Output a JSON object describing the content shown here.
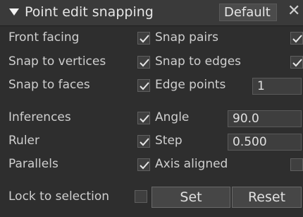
{
  "header": {
    "title": "Point edit snapping",
    "preset": "Default",
    "close_glyph": "✕"
  },
  "rows": {
    "front_facing": {
      "label": "Front facing",
      "checked": true
    },
    "snap_pairs": {
      "label": "Snap pairs",
      "checked": true
    },
    "snap_to_vertices": {
      "label": "Snap to vertices",
      "checked": true
    },
    "snap_to_edges": {
      "label": "Snap to edges",
      "checked": true
    },
    "snap_to_faces": {
      "label": "Snap to faces",
      "checked": true
    },
    "edge_points": {
      "label": "Edge points",
      "value": "1"
    },
    "inferences": {
      "label": "Inferences",
      "checked": true
    },
    "angle": {
      "label": "Angle",
      "value": "90.0"
    },
    "ruler": {
      "label": "Ruler",
      "checked": true
    },
    "step": {
      "label": "Step",
      "value": "0.500"
    },
    "parallels": {
      "label": "Parallels",
      "checked": true
    },
    "axis_aligned": {
      "label": "Axis aligned",
      "checked": false
    },
    "lock_to_selection": {
      "label": "Lock to selection",
      "checked": false
    }
  },
  "buttons": {
    "set": "Set",
    "reset": "Reset"
  }
}
